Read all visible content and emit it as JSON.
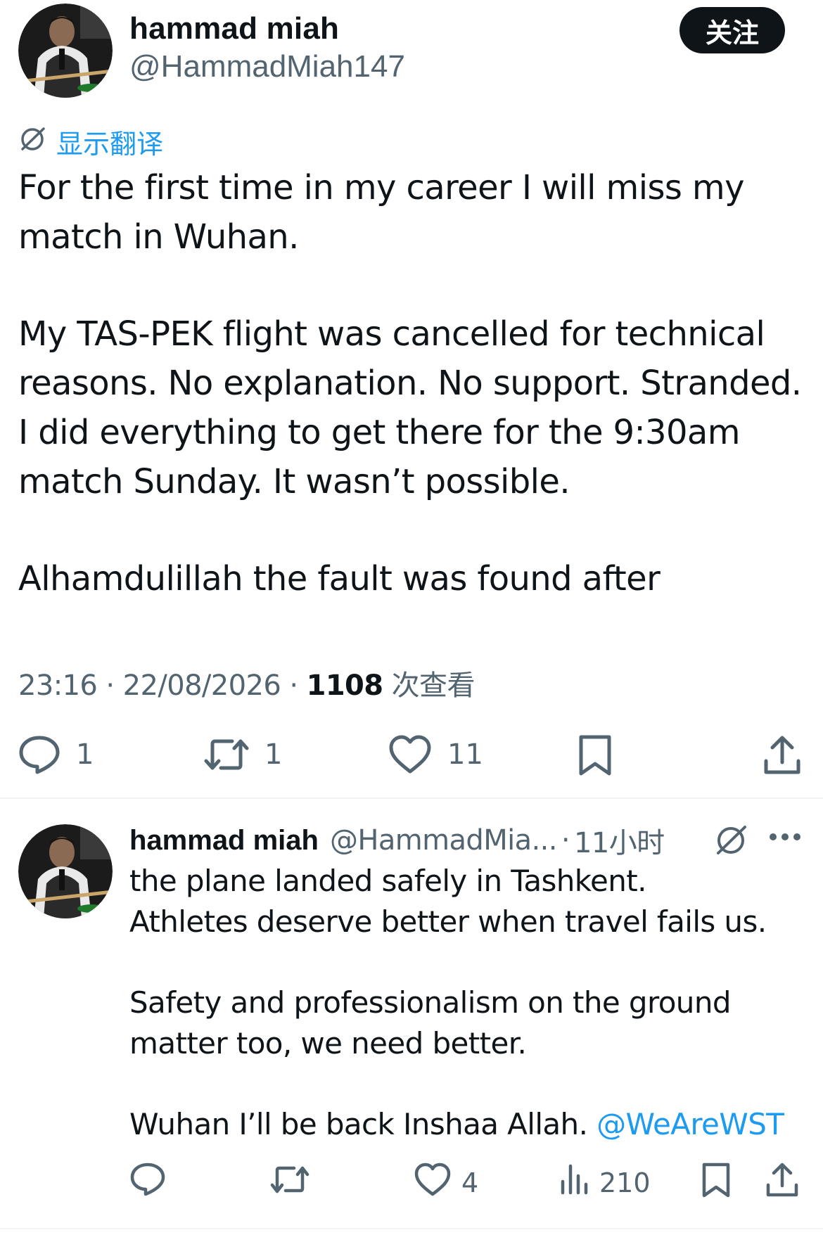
{
  "main_tweet": {
    "author_name": "hammad miah",
    "author_handle": "@HammadMiah147",
    "follow_label": "关注",
    "translate_label": "显示翻译",
    "paragraphs": [
      "For the first time in my career I will miss my\nmatch in Wuhan.",
      "My TAS-PEK flight was cancelled for technical\nreasons. No explanation. No support. Stranded.\nI did everything to get there for the 9:30am\nmatch Sunday. It wasn’t possible.",
      "Alhamdulillah the fault was found after"
    ],
    "time": "23:16",
    "date": "22/08/2026",
    "views_count": "1108",
    "views_label": "次查看",
    "separator": "·",
    "actions": {
      "reply_count": "1",
      "retweet_count": "1",
      "like_count": "11"
    }
  },
  "reply_tweet": {
    "author_name": "hammad miah",
    "author_handle": "@HammadMia...",
    "time_ago": "11小时",
    "separator": "·",
    "paragraphs": [
      "the plane landed safely in Tashkent.\nAthletes deserve better when travel fails us.",
      "Safety and professionalism on the ground\nmatter too, we need better."
    ],
    "last_line_text": "Wuhan I’ll be back Inshaa Allah. ",
    "mention": "@WeAreWST",
    "actions": {
      "like_count": "4",
      "views_count": "210"
    }
  },
  "colors": {
    "text": "#0f1419",
    "secondary": "#536471",
    "accent": "#1d9bf0",
    "button_bg": "#0f1419",
    "divider": "#eff3f4"
  },
  "icons": [
    "no-translate-icon",
    "reply-icon",
    "retweet-icon",
    "like-icon",
    "bookmark-icon",
    "share-icon",
    "views-icon",
    "more-icon"
  ]
}
